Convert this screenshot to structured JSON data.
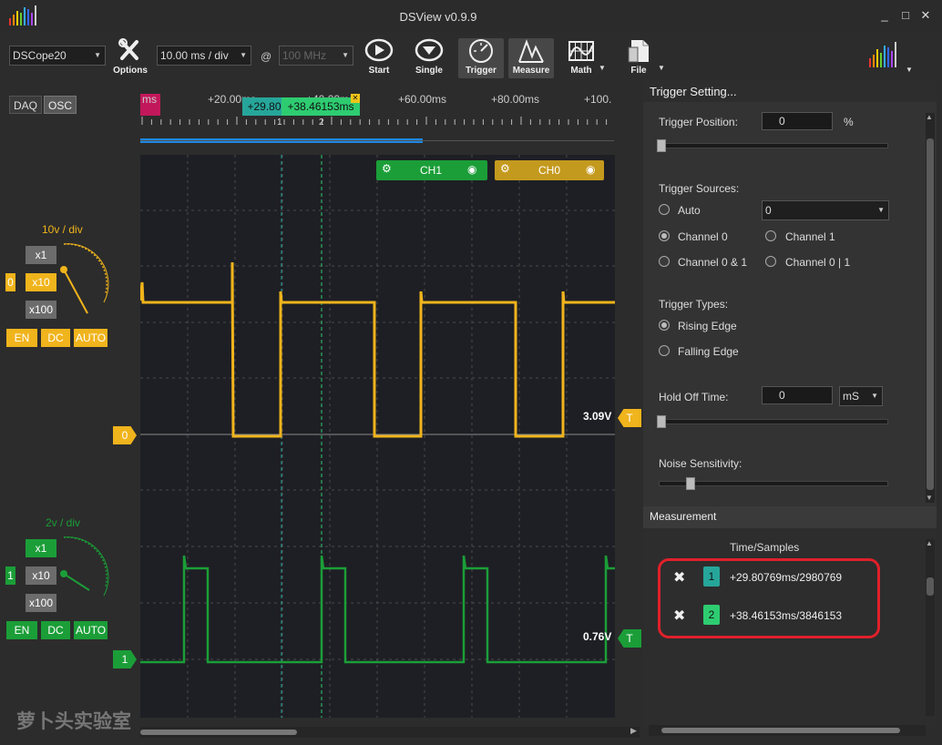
{
  "window": {
    "title": "DSView v0.9.9",
    "min": "_",
    "max": "□",
    "close": "✕"
  },
  "toolbar": {
    "device": "DSCope20",
    "timebase": "10.00 ms / div",
    "at": "@",
    "samplerate": "100 MHz",
    "options": "Options",
    "start": "Start",
    "single": "Single",
    "trigger": "Trigger",
    "measure": "Measure",
    "math": "Math",
    "file": "File"
  },
  "mode": {
    "daq": "DAQ",
    "osc": "OSC"
  },
  "ch0": {
    "scale": "10v / div",
    "x1": "x1",
    "x10": "x10",
    "x100": "x100",
    "index": "0",
    "en": "EN",
    "dc": "DC",
    "auto": "AUTO",
    "color": "#f0b41c"
  },
  "ch1": {
    "scale": "2v / div",
    "x1": "x1",
    "x10": "x10",
    "x100": "x100",
    "index": "1",
    "en": "EN",
    "dc": "DC",
    "auto": "AUTO",
    "color": "#1b9e38"
  },
  "ruler": {
    "ticks": [
      "ms",
      "+20.00ms",
      "+40.00ms",
      "+60.00ms",
      "+80.00ms",
      "+100."
    ],
    "cursor1": "+29.80",
    "cursor2": "+38.46153ms",
    "cursor1_num": "1",
    "cursor2_num": "2",
    "cursor_close": "✕"
  },
  "plot": {
    "ch1_tag": "CH1",
    "ch0_tag": "CH0",
    "ch0_marker": "0",
    "ch1_marker": "1",
    "trig0_level": "3.09V",
    "trig1_level": "0.76V",
    "trig_label": "T"
  },
  "trigger_panel": {
    "title": "Trigger Setting...",
    "position_label": "Trigger Position:",
    "position_value": "0",
    "position_unit": "%",
    "position_pct": 0,
    "sources_label": "Trigger Sources:",
    "auto": "Auto",
    "auto_value": "0",
    "channel0": "Channel 0",
    "channel1": "Channel 1",
    "channel0and1": "Channel 0 & 1",
    "channel0or1": "Channel 0 | 1",
    "types_label": "Trigger Types:",
    "rising": "Rising Edge",
    "falling": "Falling Edge",
    "holdoff_label": "Hold Off Time:",
    "holdoff_value": "0",
    "holdoff_unit": "mS",
    "noise_label": "Noise Sensitivity:"
  },
  "measurement": {
    "title": "Measurement",
    "column": "Time/Samples",
    "rows": [
      {
        "num": "1",
        "value": "+29.80769ms/2980769"
      },
      {
        "num": "2",
        "value": "+38.46153ms/3846153"
      }
    ],
    "remove": "✖"
  },
  "watermark": "萝卜头实验室"
}
